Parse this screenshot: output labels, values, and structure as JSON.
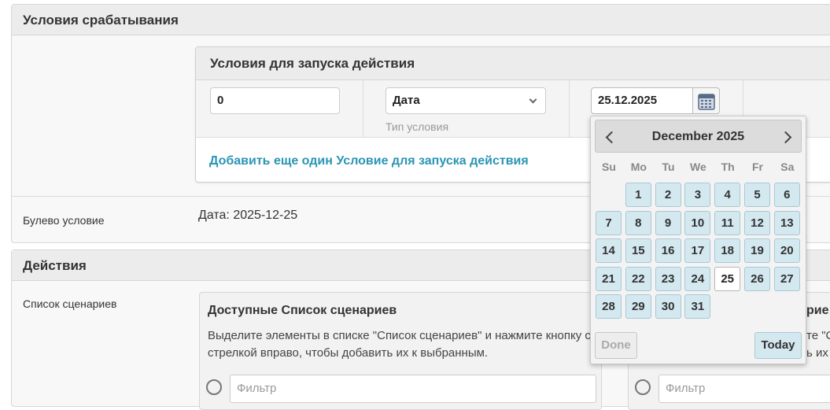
{
  "conditions_module": {
    "title": "Условия срабатывания",
    "inline": {
      "title": "Условия для запуска действия",
      "order_value": "0",
      "type_select": "Дата",
      "type_help": "Тип условия",
      "date_value": "25.12.2025",
      "add_link": "Добавить еще один Условие для запуска действия"
    },
    "bool_label": "Булево условие",
    "bool_value": "Дата: 2025-12-25"
  },
  "actions_module": {
    "title": "Действия",
    "scenarios_label": "Список сценариев",
    "available": {
      "title": "Доступные Список сценариев",
      "help": "Выделите элементы в списке \"Список сценариев\" и нажмите кнопку со стрелкой вправо, чтобы добавить их к выбранным.",
      "filter_placeholder": "Фильтр"
    },
    "chosen": {
      "title_fragment": "рие",
      "help_fragment_1": "те \"С",
      "help_fragment_2": "ь их",
      "filter_placeholder": "Фильтр"
    }
  },
  "datepicker": {
    "title": "December 2025",
    "weekdays": [
      "Su",
      "Mo",
      "Tu",
      "We",
      "Th",
      "Fr",
      "Sa"
    ],
    "first_weekday_index": 1,
    "days_in_month": 31,
    "selected_day": 25,
    "done_label": "Done",
    "today_label": "Today"
  },
  "colors": {
    "link": "#2a95b4",
    "day_bg": "#d4e8f0"
  }
}
